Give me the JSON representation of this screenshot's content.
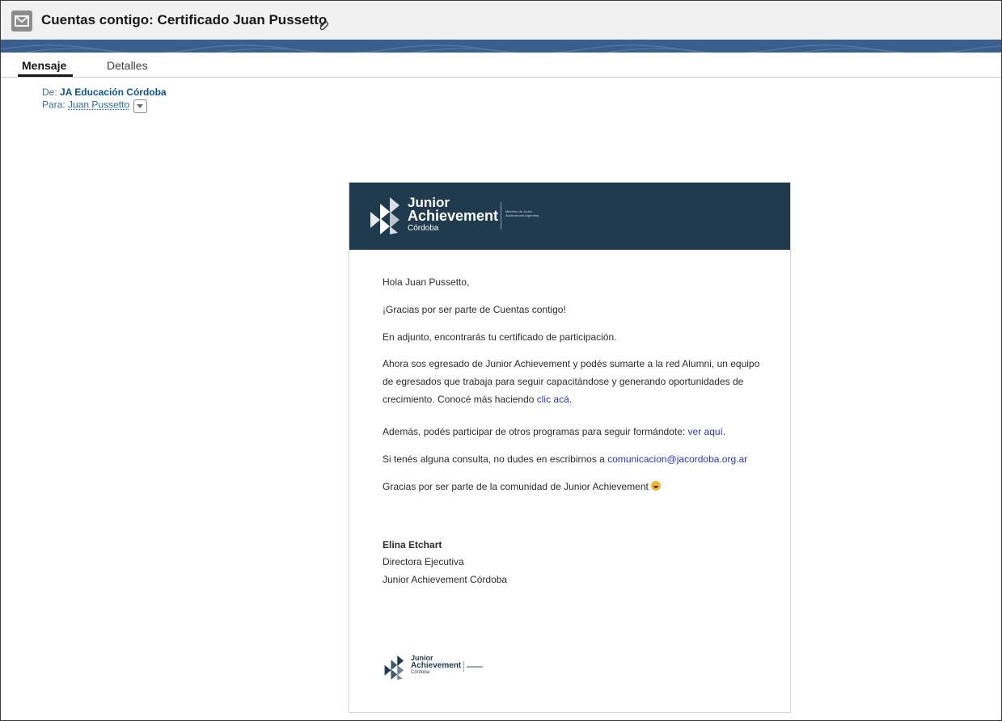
{
  "header": {
    "title": "Cuentas contigo: Certificado Juan Pussetto",
    "icon": "envelope-icon"
  },
  "tabs": [
    {
      "label": "Mensaje"
    },
    {
      "label": "Detalles"
    }
  ],
  "meta": {
    "from_label": "De:",
    "from_value": "JA Educación Córdoba",
    "to_label": "Para:",
    "to_value": "Juan Pussetto"
  },
  "email": {
    "logo": {
      "line1": "Junior",
      "line2": "Achievement",
      "line3": "Córdoba",
      "member": "Miembro de Junior Achievement Argentina"
    },
    "greeting": "Hola Juan Pussetto,",
    "thanks": "¡Gracias por ser parte de Cuentas contigo!",
    "attachment": "En adjunto, encontrarás tu certificado de participación.",
    "alumni_text": "Ahora sos egresado de Junior Achievement y podés sumarte a la red Alumni, un equipo de egresados que trabaja para seguir capacitándose y generando oportunidades de crecimiento. Conocé más haciendo ",
    "alumni_link": "clic acá",
    "alumni_end": ".",
    "programs_text": "Además, podés participar de otros programas para seguir formándote: ",
    "programs_link": "ver aquí",
    "programs_end": ".",
    "contact_text": "Si tenés alguna consulta, no dudes en escribirnos a ",
    "contact_link": "comunicacion@jacordoba.org.ar",
    "community": "Gracias por ser parte de la comunidad de Junior Achievement",
    "signature": {
      "name": "Elina Etchart",
      "role": "Directora Ejecutiva",
      "org": "Junior Achievement Córdoba"
    }
  },
  "colors": {
    "header_band": "#1f3b4d",
    "banner": "#3a5f8f",
    "link": "#2a34c8"
  }
}
